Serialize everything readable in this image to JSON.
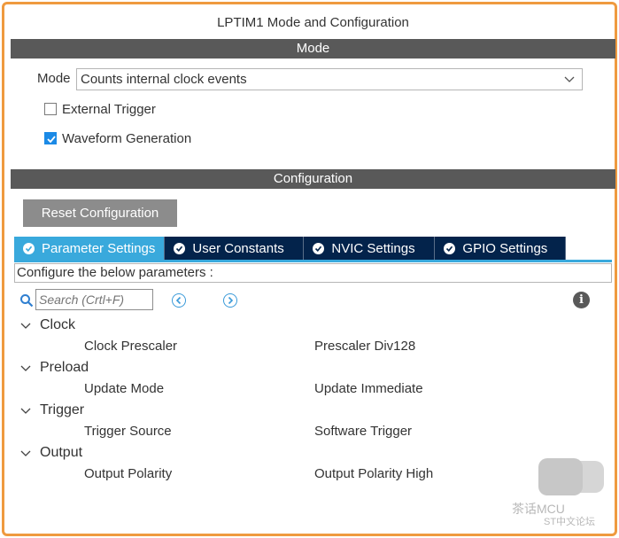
{
  "window": {
    "title": "LPTIM1 Mode and Configuration"
  },
  "mode_section": {
    "header": "Mode",
    "mode_label": "Mode",
    "mode_value": "Counts internal clock events",
    "external_trigger": {
      "label": "External Trigger",
      "checked": false
    },
    "waveform_generation": {
      "label": "Waveform Generation",
      "checked": true
    }
  },
  "config_section": {
    "header": "Configuration",
    "reset_button": "Reset Configuration",
    "tabs": [
      {
        "label": "Parameter Settings",
        "active": true
      },
      {
        "label": "User Constants",
        "active": false
      },
      {
        "label": "NVIC Settings",
        "active": false
      },
      {
        "label": "GPIO Settings",
        "active": false
      }
    ],
    "configure_text": "Configure the below parameters :",
    "search": {
      "placeholder": "Search (Crtl+F)",
      "value": ""
    }
  },
  "parameters": [
    {
      "group": "Clock",
      "items": [
        {
          "name": "Clock Prescaler",
          "value": "Prescaler Div128"
        }
      ]
    },
    {
      "group": "Preload",
      "items": [
        {
          "name": "Update Mode",
          "value": "Update Immediate"
        }
      ]
    },
    {
      "group": "Trigger",
      "items": [
        {
          "name": "Trigger Source",
          "value": "Software Trigger"
        }
      ]
    },
    {
      "group": "Output",
      "items": [
        {
          "name": "Output Polarity",
          "value": "Output Polarity High"
        }
      ]
    }
  ],
  "watermark": {
    "name": "茶话MCU",
    "sub": "ST中文论坛"
  },
  "colors": {
    "accent": "#39a9dc",
    "tab_dark": "#03234b",
    "section_bar": "#595959",
    "frame_border": "#ef9a3f",
    "checkbox_checked": "#1b8ae6"
  },
  "icons": [
    "chevron-down-icon",
    "checkmark-icon",
    "search-icon",
    "chevron-left-icon",
    "chevron-right-icon",
    "info-icon",
    "expand-caret-icon"
  ]
}
